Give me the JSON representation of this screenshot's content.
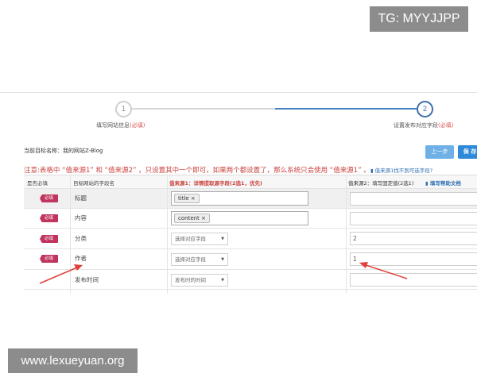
{
  "watermarks": {
    "top": "TG: MYYJJPP",
    "bottom": "www.lexueyuan.org"
  },
  "stepper": {
    "step1": {
      "number": "1",
      "label": "填写网站信息",
      "req": "(必填)"
    },
    "step2": {
      "number": "2",
      "label": "设置发布对应字段",
      "req": "(必填)"
    }
  },
  "target_site": "当前目标名称：我的网站Z-Blog",
  "buttons": {
    "prev": "上一步",
    "save": "保 存"
  },
  "notice": "注意:表格中 “值来源1” 和 “值来源2” ，只设置其中一个即可，如果两个都设置了，那么系统只会使用 “值来源1” 。",
  "notice_link": "值来源1找不到可选字段?",
  "table": {
    "headers": [
      "是否必填",
      "目标网站的字段名",
      "值来源1：详情提取源字段(2选1，优先)",
      "值来源2：填写固定值(2选1)",
      "填写帮助文档"
    ],
    "required_badge": "必填",
    "rows": [
      {
        "field": "标题",
        "tag": "title ×"
      },
      {
        "field": "内容",
        "tag": "content ×"
      },
      {
        "field": "分类",
        "select": "选择对应字段",
        "fixed": "2"
      },
      {
        "field": "作者",
        "select": "选择对应字段",
        "fixed": "1"
      },
      {
        "field": "发布时间",
        "select": "发布时的时间",
        "fixed": ""
      }
    ]
  },
  "colors": {
    "accent": "#2e8ad8",
    "required": "#c0345e",
    "warning": "#c9423d",
    "arrow": "#e0403a"
  }
}
